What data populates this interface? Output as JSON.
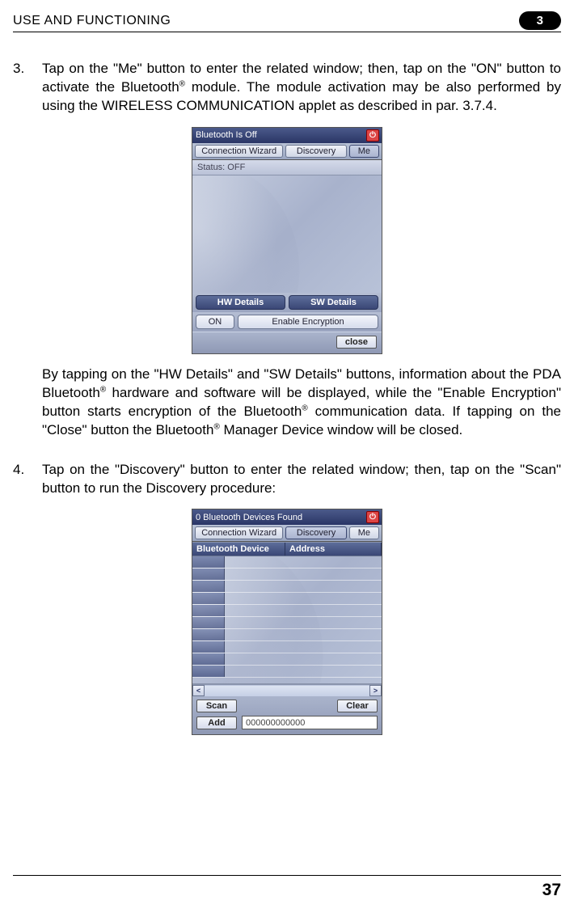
{
  "header": {
    "title": "USE AND FUNCTIONING",
    "chapter": "3"
  },
  "steps": {
    "s3": {
      "num": "3.",
      "text_a": "Tap on the \"Me\" button to enter the related window; then, tap on the \"ON\" button to activate the Bluetooth",
      "text_b": " module. The module activation may be also performed by using the WIRELESS COMMUNICATION applet as described in par. 3.7.4."
    },
    "s3_after_a": "By tapping on the \"HW Details\" and \"SW Details\" buttons, information about the PDA Bluetooth",
    "s3_after_b": " hardware and software will be displayed, while the \"Enable Encryption\" button starts encryption of the Bluetooth",
    "s3_after_c": " communication data. If tapping on the \"Close\" button the Bluetooth",
    "s3_after_d": " Manager Device window will be closed.",
    "s4": {
      "num": "4.",
      "text": "Tap on the \"Discovery\" button to enter the related window; then, tap on the \"Scan\" button to run the Discovery procedure:"
    }
  },
  "pda1": {
    "title": "Bluetooth Is Off",
    "tabs": {
      "conn": "Connection Wizard",
      "disc": "Discovery",
      "me": "Me"
    },
    "status": "Status: OFF",
    "btns": {
      "hw": "HW Details",
      "sw": "SW Details",
      "on": "ON",
      "enc": "Enable Encryption",
      "close": "close"
    }
  },
  "pda2": {
    "title": "0 Bluetooth Devices Found",
    "tabs": {
      "conn": "Connection Wizard",
      "disc": "Discovery",
      "me": "Me"
    },
    "cols": {
      "c1": "Bluetooth Device",
      "c2": "Address"
    },
    "scroll": {
      "left": "<",
      "right": ">"
    },
    "btns": {
      "scan": "Scan",
      "clear": "Clear",
      "add": "Add"
    },
    "input_val": "000000000000"
  },
  "footer": {
    "page": "37"
  }
}
